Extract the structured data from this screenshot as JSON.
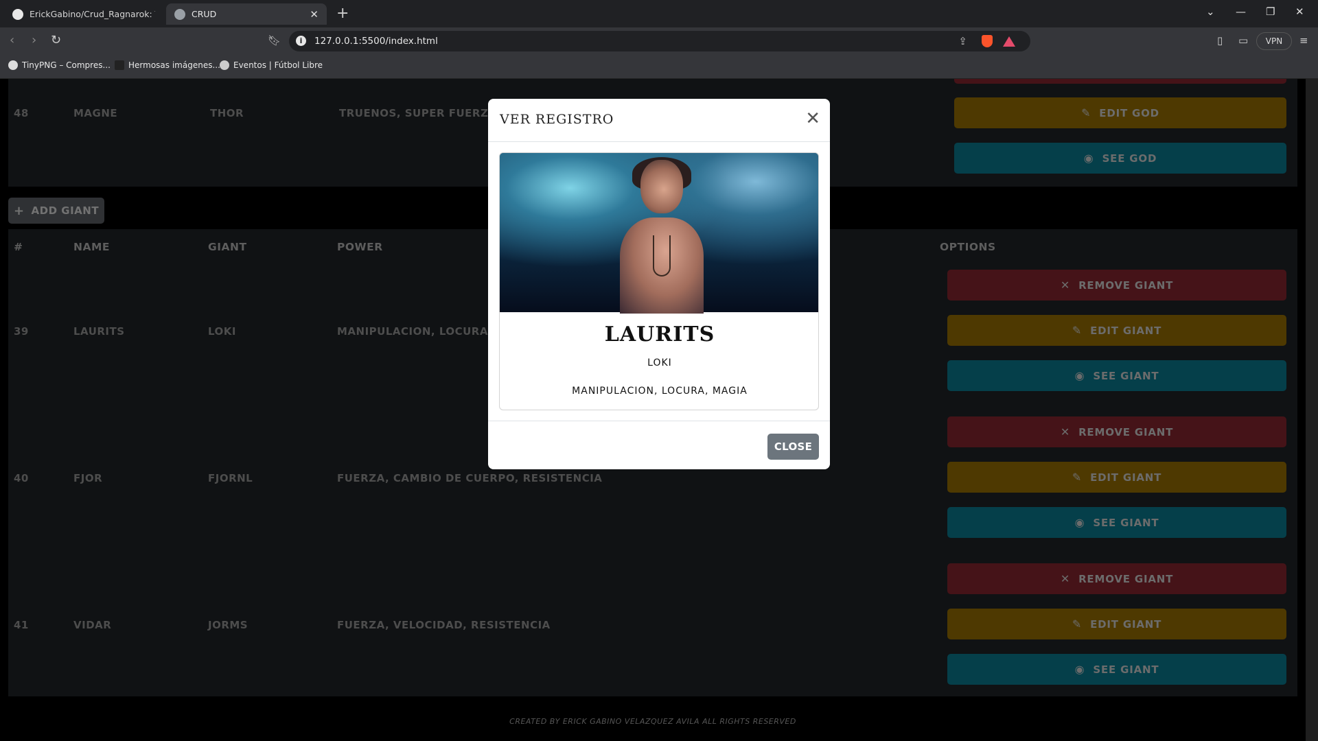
{
  "browser": {
    "tabs": [
      {
        "title": "ErickGabino/Crud_Ragnarok: This is"
      },
      {
        "title": "CRUD"
      }
    ],
    "url": "127.0.0.1:5500/index.html",
    "vpn_label": "VPN",
    "bookmarks": [
      "TinyPNG – Compres...",
      "Hermosas imágenes...",
      "Eventos | Fútbol Libre"
    ]
  },
  "gods_row": {
    "id": "48",
    "name": "MAGNE",
    "god": "THOR",
    "power": "TRUENOS, SUPER FUERZA Y R",
    "edit_label": "EDIT GOD",
    "see_label": "SEE GOD"
  },
  "add_giant_label": "ADD GIANT",
  "giants_table": {
    "headers": [
      "#",
      "NAME",
      "GIANT",
      "POWER",
      "OPTIONS"
    ],
    "remove_label": "REMOVE GIANT",
    "edit_label": "EDIT GIANT",
    "see_label": "SEE GIANT",
    "rows": [
      {
        "id": "39",
        "name": "LAURITS",
        "giant": "LOKI",
        "power": "MANIPULACION, LOCURA, MAG"
      },
      {
        "id": "40",
        "name": "FJOR",
        "giant": "FJORNL",
        "power": "FUERZA, CAMBIO DE CUERPO, RESISTENCIA"
      },
      {
        "id": "41",
        "name": "VIDAR",
        "giant": "JORMS",
        "power": "FUERZA, VELOCIDAD, RESISTENCIA"
      }
    ]
  },
  "footer": "CREATED BY ERICK GABINO VELAZQUEZ AVILA ALL RIGHTS RESERVED",
  "modal": {
    "title": "VER REGISTRO",
    "name": "LAURITS",
    "god": "LOKI",
    "power": "MANIPULACION, LOCURA, MAGIA",
    "close_label": "CLOSE"
  },
  "colors": {
    "remove": "#8b2730",
    "edit": "#9c7203",
    "see": "#0a7e94",
    "panel": "#212529"
  }
}
